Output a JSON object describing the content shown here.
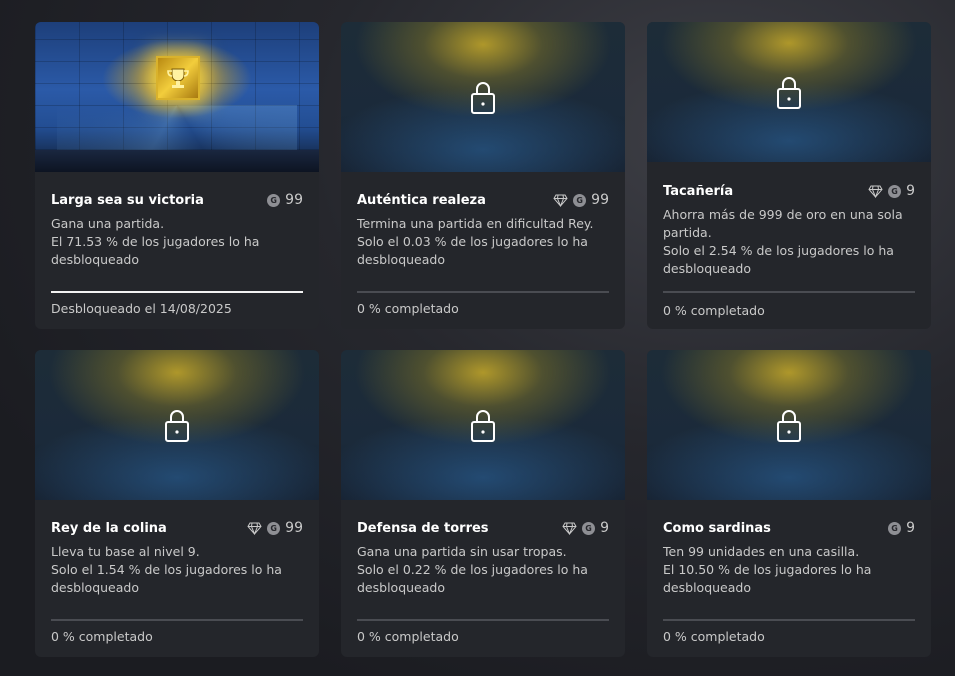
{
  "points_icon": "G",
  "achievements": [
    {
      "title": "Larga sea su victoria",
      "gamerscore": "99",
      "rare": false,
      "unlocked": true,
      "description": "Gana una partida.",
      "rarity": "El 71.53 % de los jugadores lo ha desbloqueado",
      "status": "Desbloqueado el 14/08/2025",
      "image_icon": "trophy-icon",
      "progress": 1.0
    },
    {
      "title": "Auténtica realeza",
      "gamerscore": "99",
      "rare": true,
      "unlocked": false,
      "description": "Termina una partida en dificultad Rey.",
      "rarity": "Solo el 0.03 % de los jugadores lo ha desbloqueado",
      "status": "0 % completado",
      "image_icon": "lock-icon",
      "progress": 0
    },
    {
      "title": "Tacañería",
      "gamerscore": "9",
      "rare": true,
      "unlocked": false,
      "description": "Ahorra más de 999 de oro en una sola partida.",
      "rarity": "Solo el 2.54 % de los jugadores lo ha desbloqueado",
      "status": "0 % completado",
      "image_icon": "lock-icon",
      "progress": 0
    },
    {
      "title": "Rey de la colina",
      "gamerscore": "99",
      "rare": true,
      "unlocked": false,
      "description": "Lleva tu base al nivel 9.",
      "rarity": "Solo el 1.54 % de los jugadores lo ha desbloqueado",
      "status": "0 % completado",
      "image_icon": "lock-icon",
      "progress": 0
    },
    {
      "title": "Defensa de torres",
      "gamerscore": "9",
      "rare": true,
      "unlocked": false,
      "description": "Gana una partida sin usar tropas.",
      "rarity": "Solo el 0.22 % de los jugadores lo ha desbloqueado",
      "status": "0 % completado",
      "image_icon": "lock-icon",
      "progress": 0
    },
    {
      "title": "Como sardinas",
      "gamerscore": "9",
      "rare": false,
      "unlocked": false,
      "description": "Ten 99 unidades en una casilla.",
      "rarity": "El 10.50 % de los jugadores lo ha desbloqueado",
      "status": "0 % completado",
      "image_icon": "lock-icon",
      "progress": 0
    }
  ]
}
